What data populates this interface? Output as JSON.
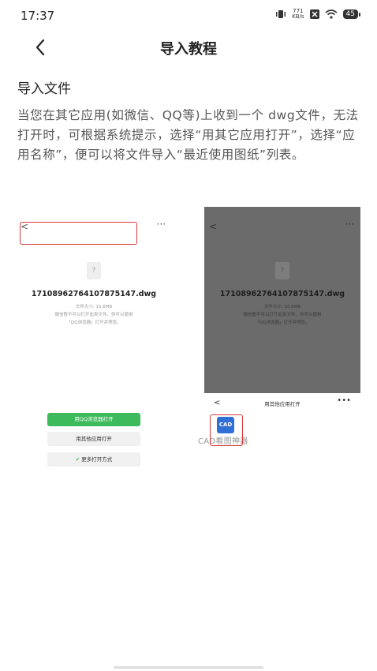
{
  "status": {
    "time": "17:37",
    "net_speed_value": "771",
    "net_speed_unit": "KB/s",
    "battery": "45"
  },
  "header": {
    "title": "导入教程"
  },
  "section": {
    "title": "导入文件",
    "description": "当您在其它应用(如微信、QQ等)上收到一个 dwg文件，无法打开时，可根据系统提示，选择“用其它应用打开”，选择“应用名称”，便可以将文件导入“最近使用图纸”列表。"
  },
  "mock_left": {
    "back": "<",
    "more": "···",
    "file_icon": "?",
    "file_name": "17108962764107875147.dwg",
    "file_size": "文件大小: 15.6MB",
    "file_note_1": "微信暂不可以打开此类文件，你可以使用",
    "file_note_2": "「QQ浏览器」打开并预览。",
    "btn_qq": "用QQ浏览器打开",
    "btn_other": "用其他应用打开",
    "btn_more_ways": "更多打开方式"
  },
  "mock_right": {
    "back": "<",
    "more": "···",
    "file_icon": "?",
    "file_name": "17108962764107875147.dwg",
    "file_size": "文件大小: 15.6MB",
    "file_note_1": "微信暂不可以打开此类文件，你可以使用",
    "file_note_2": "「QQ浏览器」打开并预览。",
    "sheet_back": "<",
    "sheet_title": "用其他应用打开",
    "sheet_more": "•••",
    "cad_tile": "CAD",
    "cad_label": "CAD看图神器"
  },
  "colors": {
    "highlight": "#d83a3a",
    "green": "#3dbb5c",
    "cad_blue": "#2f6fd6"
  }
}
